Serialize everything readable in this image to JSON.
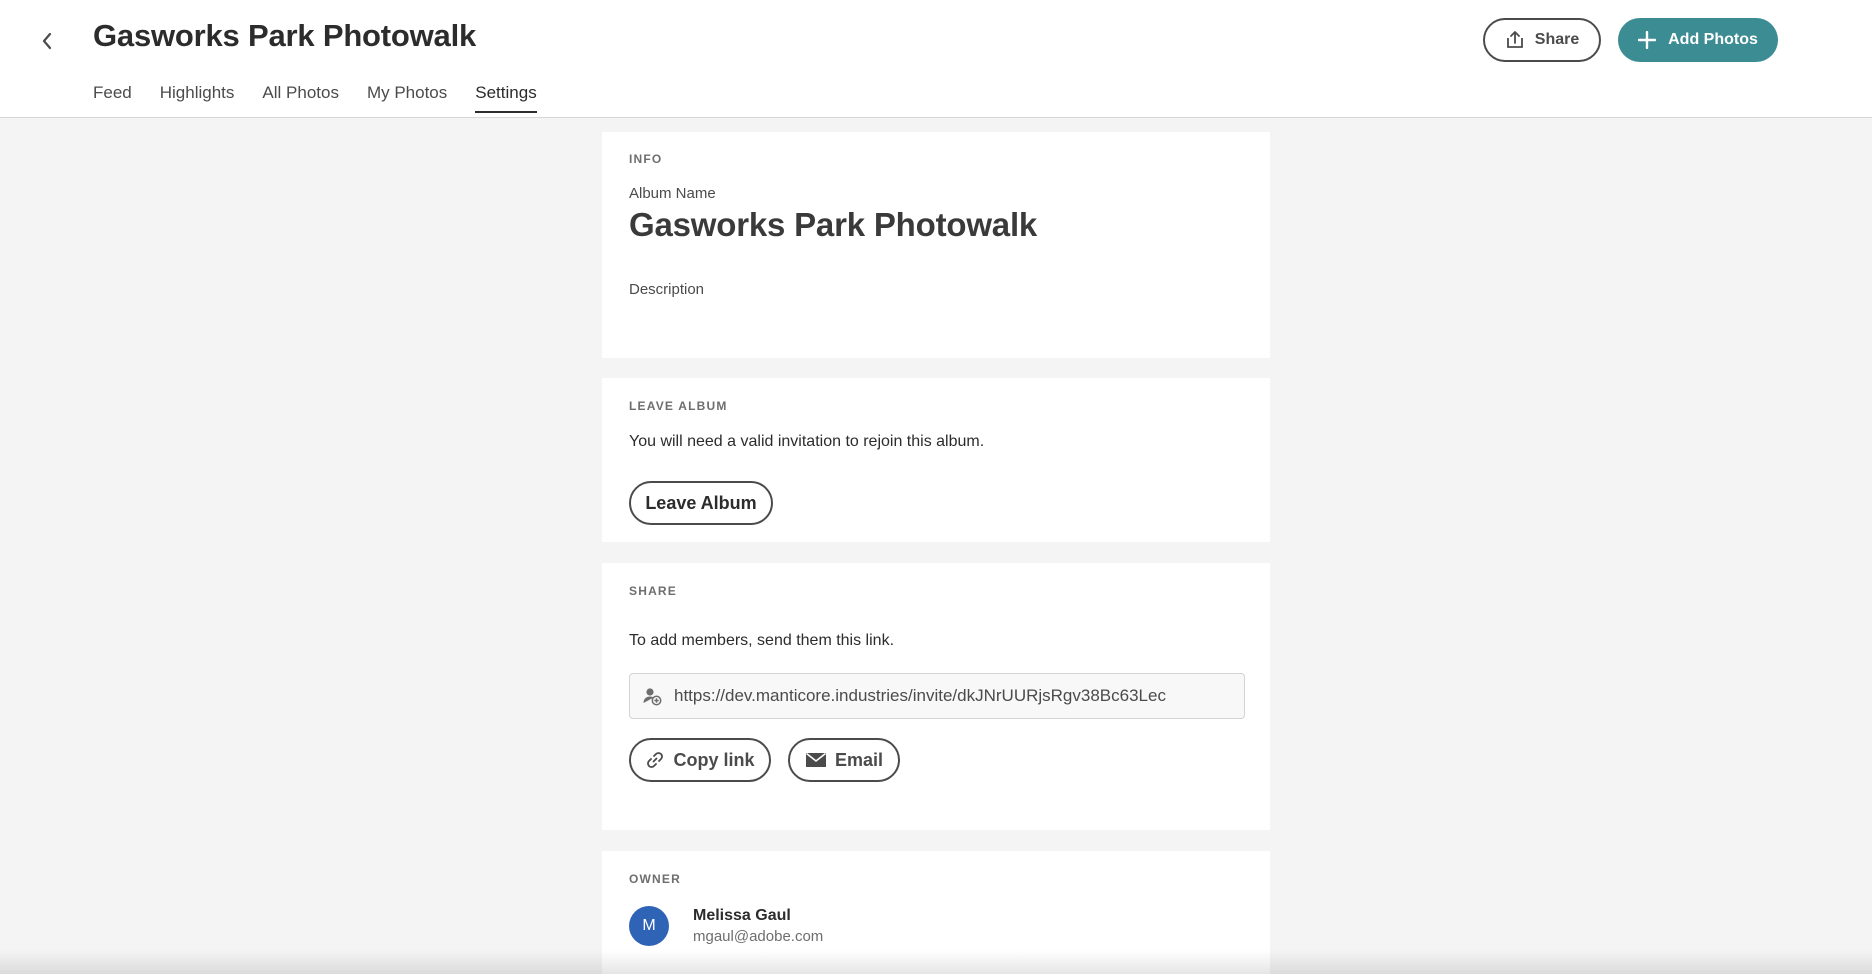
{
  "header": {
    "title": "Gasworks Park Photowalk",
    "tabs": [
      {
        "label": "Feed"
      },
      {
        "label": "Highlights"
      },
      {
        "label": "All Photos"
      },
      {
        "label": "My Photos"
      },
      {
        "label": "Settings",
        "active": true
      }
    ],
    "share_label": "Share",
    "add_photos_label": "Add Photos"
  },
  "info": {
    "section_label": "INFO",
    "album_name_label": "Album Name",
    "album_name_value": "Gasworks Park Photowalk",
    "description_label": "Description"
  },
  "leave": {
    "section_label": "LEAVE ALBUM",
    "message": "You will need a valid invitation to rejoin this album.",
    "button_label": "Leave Album"
  },
  "share": {
    "section_label": "SHARE",
    "message": "To add members, send them this link.",
    "invite_link": "https://dev.manticore.industries/invite/dkJNrUURjsRgv38Bc63Lec",
    "copy_link_label": "Copy link",
    "email_label": "Email"
  },
  "owner": {
    "section_label": "OWNER",
    "avatar_initial": "M",
    "name": "Melissa Gaul",
    "email": "mgaul@adobe.com"
  },
  "colors": {
    "accent": "#3c8c93",
    "avatar": "#2f63b6",
    "background": "#f4f4f4"
  },
  "icons": [
    "chevron-left-icon",
    "share-upload-icon",
    "plus-icon",
    "add-person-icon",
    "link-icon",
    "mail-icon"
  ]
}
